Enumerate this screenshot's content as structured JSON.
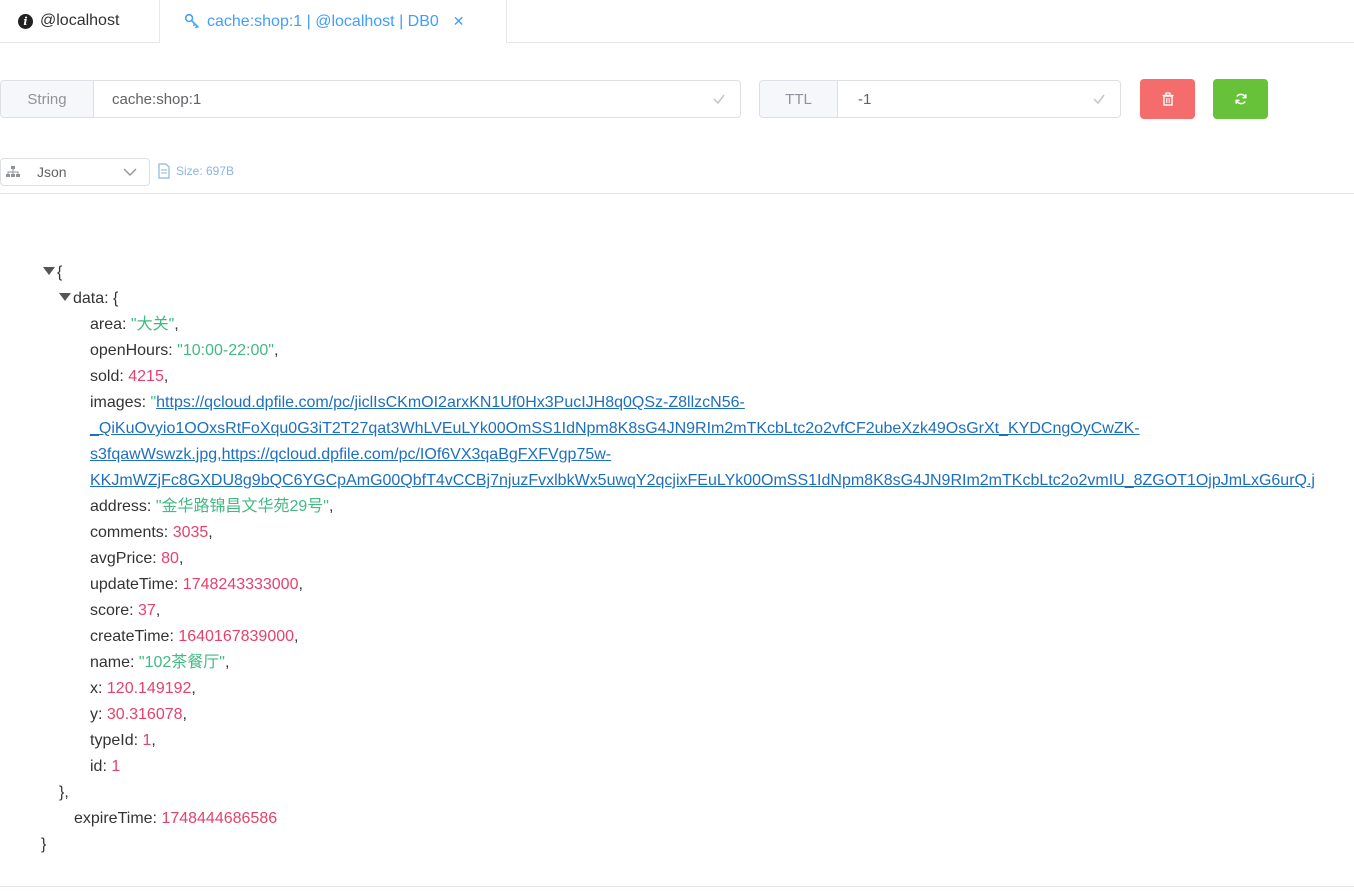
{
  "tabs": [
    {
      "label": "@localhost"
    },
    {
      "label": "cache:shop:1 | @localhost | DB0"
    }
  ],
  "key_row": {
    "type_label": "String",
    "key_value": "cache:shop:1",
    "ttl_label": "TTL",
    "ttl_value": "-1"
  },
  "format": {
    "selected": "Json",
    "size": "Size: 697B"
  },
  "json": {
    "open": "{",
    "data_key": "data",
    "data_open": "{",
    "area_key": "area",
    "area_val": "\"大关\"",
    "openHours_key": "openHours",
    "openHours_val": "\"10:00-22:00\"",
    "sold_key": "sold",
    "sold_val": "4215",
    "images_key": "images",
    "images_quote": "\"",
    "images_line1": "https://qcloud.dpfile.com/pc/jiclIsCKmOI2arxKN1Uf0Hx3PucIJH8q0QSz-Z8llzcN56-",
    "images_line2": "_QiKuOvyio1OOxsRtFoXqu0G3iT2T27qat3WhLVEuLYk00OmSS1IdNpm8K8sG4JN9RIm2mTKcbLtc2o2vfCF2ubeXzk49OsGrXt_KYDCngOyCwZK-",
    "images_line3": "s3fqawWswzk.jpg,https://qcloud.dpfile.com/pc/IOf6VX3qaBgFXFVgp75w-",
    "images_line4": "KKJmWZjFc8GXDU8g9bQC6YGCpAmG00QbfT4vCCBj7njuzFvxlbkWx5uwqY2qcjixFEuLYk00OmSS1IdNpm8K8sG4JN9RIm2mTKcbLtc2o2vmIU_8ZGOT1OjpJmLxG6urQ.j",
    "address_key": "address",
    "address_val": "\"金华路锦昌文华苑29号\"",
    "comments_key": "comments",
    "comments_val": "3035",
    "avgPrice_key": "avgPrice",
    "avgPrice_val": "80",
    "updateTime_key": "updateTime",
    "updateTime_val": "1748243333000",
    "score_key": "score",
    "score_val": "37",
    "createTime_key": "createTime",
    "createTime_val": "1640167839000",
    "name_key": "name",
    "name_val": "\"102茶餐厅\"",
    "x_key": "x",
    "x_val": "120.149192",
    "y_key": "y",
    "y_val": "30.316078",
    "typeId_key": "typeId",
    "typeId_val": "1",
    "id_key": "id",
    "id_val": "1",
    "data_close": "},",
    "expireTime_key": "expireTime",
    "expireTime_val": "1748444686586",
    "close": "}"
  },
  "icons": {
    "tab1": "info-icon",
    "tab2": "key-icon",
    "tab_close": "close-icon",
    "delete": "trash-icon",
    "refresh": "refresh-icon",
    "format": "tree-icon",
    "size": "document-icon"
  },
  "colors": {
    "accent": "#409eff",
    "delete": "#f56c6c",
    "refresh": "#67c23a",
    "string": "#42b983",
    "number": "#e6416b"
  }
}
